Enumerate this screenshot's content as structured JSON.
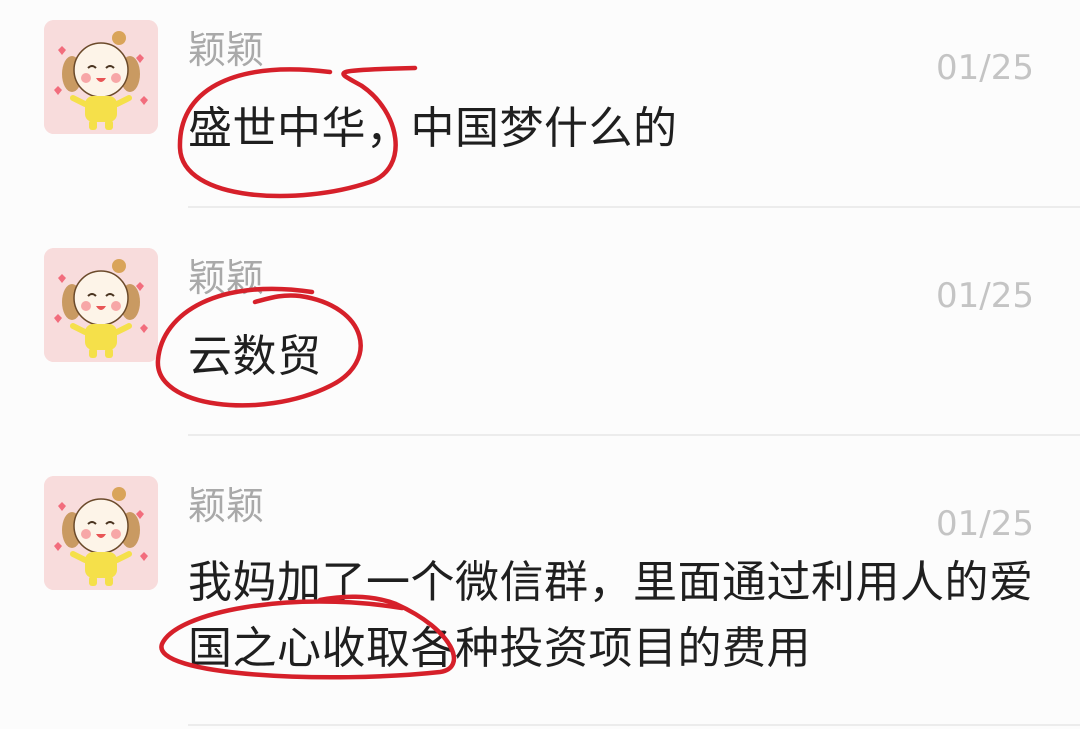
{
  "colors": {
    "background": "#fcfcfc",
    "sender_text": "#a9a9a9",
    "time_text": "#c4c4c4",
    "message_text": "#1f1f1f",
    "annotation_red": "#d6202a",
    "avatar_bg": "#f8dcdc"
  },
  "messages": [
    {
      "avatar_icon": "cartoon-dog-avatar-icon",
      "sender": "颖颖",
      "time": "01/25",
      "text": "盛世中华，中国梦什么的"
    },
    {
      "avatar_icon": "cartoon-dog-avatar-icon",
      "sender": "颖颖",
      "time": "01/25",
      "text": "云数贸"
    },
    {
      "avatar_icon": "cartoon-dog-avatar-icon",
      "sender": "颖颖",
      "time": "01/25",
      "text": "我妈加了一个微信群，里面通过利用人的爱国之心收取各种投资项目的费用"
    }
  ]
}
